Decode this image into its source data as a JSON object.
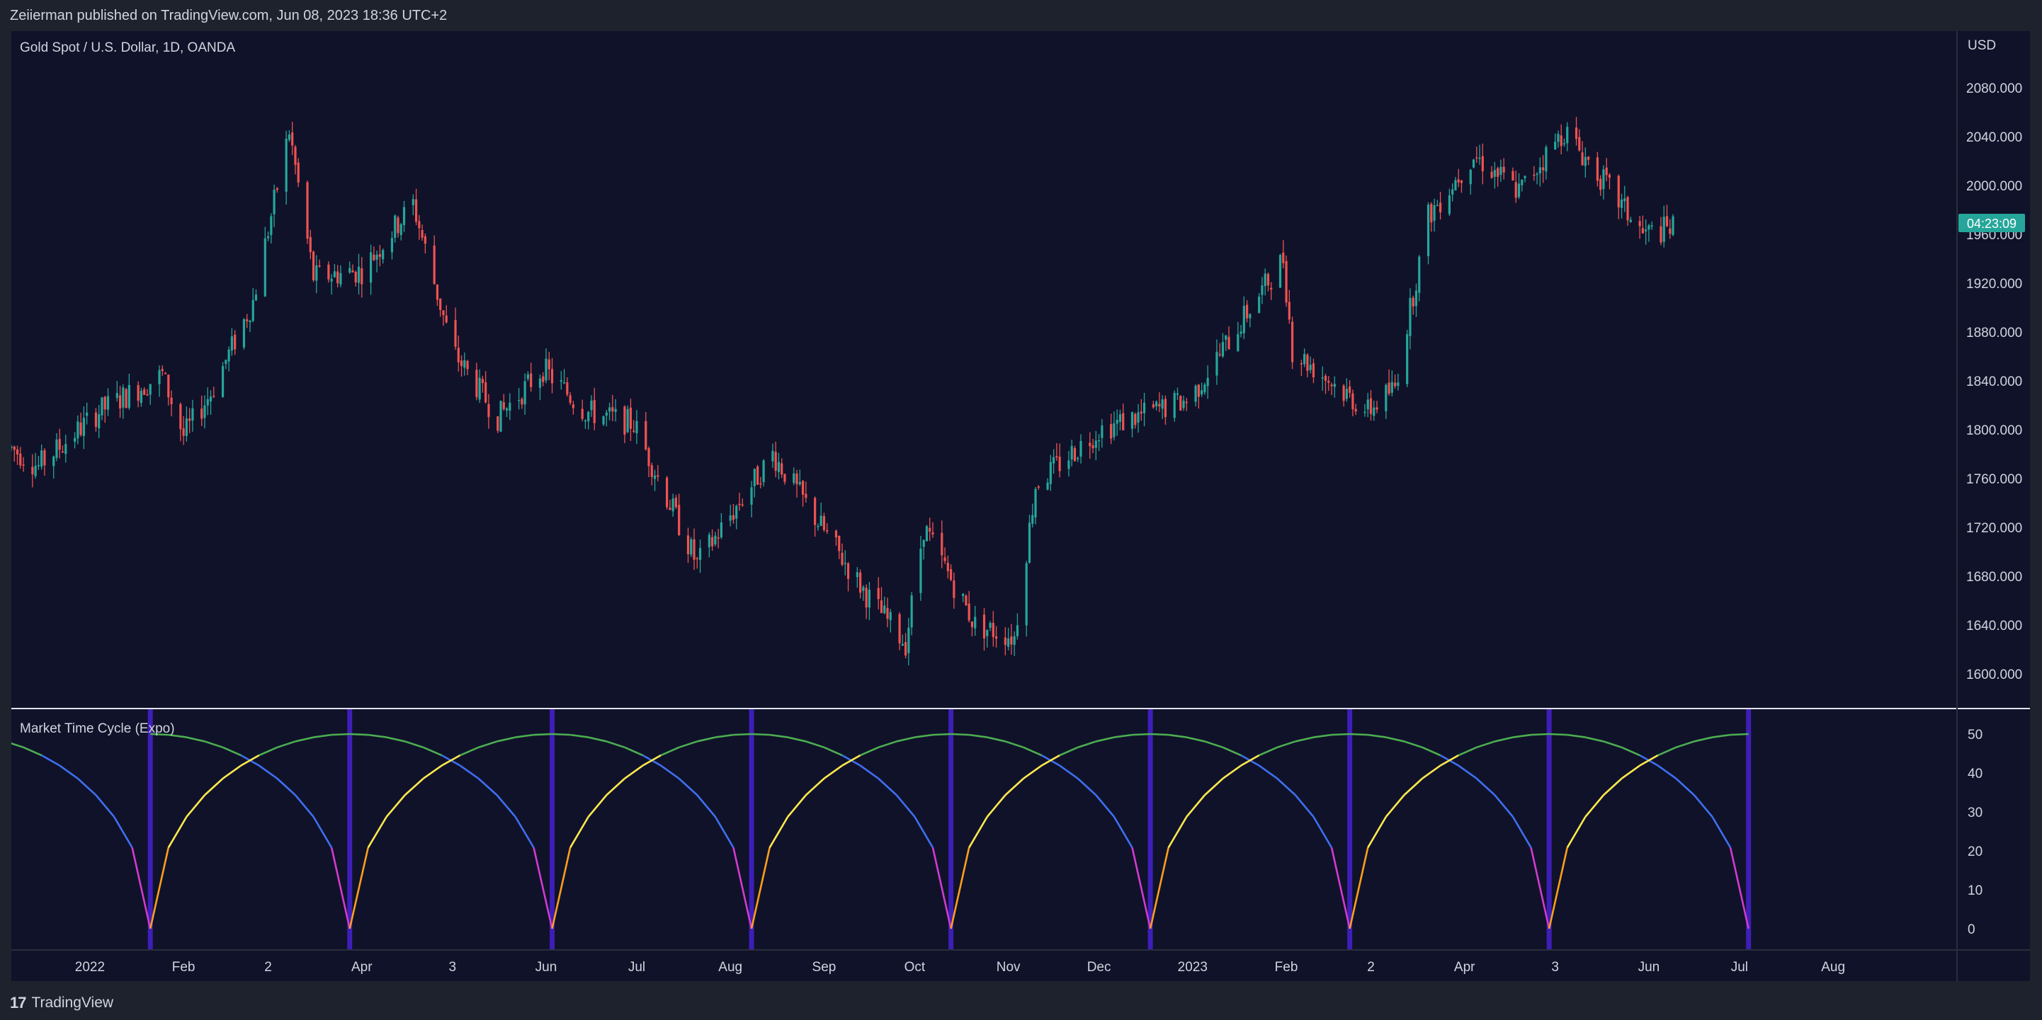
{
  "header": {
    "publish_info": "Zeiierman published on TradingView.com, Jun 08, 2023 18:36 UTC+2"
  },
  "footer": {
    "brand": "TradingView",
    "logo_icon": "tradingview-logo-icon"
  },
  "colors": {
    "background": "#10122a",
    "frame": "#1e222d",
    "up_candle": "#26a69a",
    "down_candle": "#ef5350",
    "countdown_badge": "#26a69a",
    "cycle_marker": "#3d1fb8",
    "cycle_magenta": "#d23ad0",
    "cycle_blue": "#3e6ff0",
    "cycle_green": "#4caf50",
    "cycle_yellow": "#ffe94d",
    "cycle_orange": "#ff9f1a"
  },
  "chart_data": [
    {
      "type": "candlestick",
      "title": "Gold Spot / U.S. Dollar, 1D, OANDA",
      "currency_label": "USD",
      "countdown": "04:23:09",
      "ylim": [
        1560,
        2100
      ],
      "y_ticks": [
        "2080.000",
        "2040.000",
        "2000.000",
        "1960.000",
        "1920.000",
        "1880.000",
        "1840.000",
        "1800.000",
        "1760.000",
        "1720.000",
        "1680.000",
        "1640.000",
        "1600.000"
      ],
      "x_ticks": [
        "2022",
        "Feb",
        "2",
        "Apr",
        "3",
        "Jun",
        "Jul",
        "Aug",
        "Sep",
        "Oct",
        "Nov",
        "Dec",
        "2023",
        "Feb",
        "2",
        "Apr",
        "3",
        "Jun",
        "Jul",
        "Aug"
      ],
      "x_range_dates": [
        "2021-12-06",
        "2023-09-11"
      ],
      "price_path": [
        [
          "2021-12-06",
          1785
        ],
        [
          "2021-12-15",
          1770
        ],
        [
          "2022-01-04",
          1815
        ],
        [
          "2022-01-25",
          1845
        ],
        [
          "2022-02-01",
          1795
        ],
        [
          "2022-02-10",
          1830
        ],
        [
          "2022-02-24",
          1905
        ],
        [
          "2022-03-08",
          2045
        ],
        [
          "2022-03-16",
          1925
        ],
        [
          "2022-04-01",
          1930
        ],
        [
          "2022-04-18",
          1985
        ],
        [
          "2022-05-01",
          1865
        ],
        [
          "2022-05-16",
          1810
        ],
        [
          "2022-05-31",
          1850
        ],
        [
          "2022-06-14",
          1815
        ],
        [
          "2022-06-30",
          1805
        ],
        [
          "2022-07-21",
          1690
        ],
        [
          "2022-08-15",
          1780
        ],
        [
          "2022-09-15",
          1665
        ],
        [
          "2022-09-28",
          1625
        ],
        [
          "2022-10-04",
          1720
        ],
        [
          "2022-10-21",
          1640
        ],
        [
          "2022-11-03",
          1630
        ],
        [
          "2022-11-10",
          1755
        ],
        [
          "2022-12-01",
          1800
        ],
        [
          "2022-12-31",
          1825
        ],
        [
          "2023-01-31",
          1940
        ],
        [
          "2023-02-03",
          1865
        ],
        [
          "2023-02-28",
          1815
        ],
        [
          "2023-03-09",
          1835
        ],
        [
          "2023-03-20",
          1975
        ],
        [
          "2023-04-04",
          2025
        ],
        [
          "2023-04-19",
          1995
        ],
        [
          "2023-05-04",
          2045
        ],
        [
          "2023-05-15",
          2010
        ],
        [
          "2023-05-30",
          1960
        ],
        [
          "2023-06-09",
          1965
        ]
      ]
    },
    {
      "type": "line",
      "title": "Market Time Cycle (Expo)",
      "ylim": [
        0,
        50
      ],
      "y_ticks": [
        "50",
        "40",
        "30",
        "20",
        "10",
        "0"
      ],
      "series_colors": [
        "#d23ad0",
        "#3e6ff0",
        "#4caf50",
        "#ffe94d",
        "#ff9f1a"
      ],
      "cycle_length_days": 66,
      "cycle_amplitude": 50,
      "cycle_markers": [
        "2022-01-21",
        "2022-03-28",
        "2022-06-03",
        "2022-08-08",
        "2022-10-13",
        "2022-12-18",
        "2023-02-22",
        "2023-04-29",
        "2023-07-04"
      ]
    }
  ]
}
